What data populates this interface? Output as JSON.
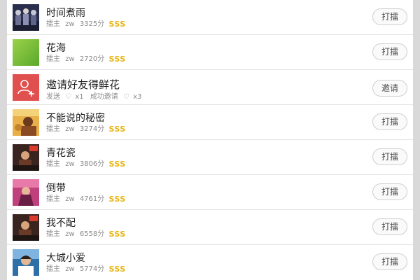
{
  "songs": [
    {
      "title": "时间煮雨",
      "owner_label": "擂主",
      "user": "zw",
      "score": "3325分",
      "rank": "SSS",
      "button": "打擂",
      "thumb_color": "#2a2f4e"
    },
    {
      "title": "花海",
      "owner_label": "擂主",
      "user": "zw",
      "score": "2720分",
      "rank": "SSS",
      "button": "打擂",
      "thumb_color": "#7cc23a"
    },
    {
      "title": "不能说的秘密",
      "owner_label": "擂主",
      "user": "zw",
      "score": "3274分",
      "rank": "SSS",
      "button": "打擂",
      "thumb_color": "#c4832a"
    },
    {
      "title": "青花瓷",
      "owner_label": "擂主",
      "user": "zw",
      "score": "3806分",
      "rank": "SSS",
      "button": "打擂",
      "thumb_color": "#4a2a22"
    },
    {
      "title": "倒带",
      "owner_label": "擂主",
      "user": "zw",
      "score": "4761分",
      "rank": "SSS",
      "button": "打擂",
      "thumb_color": "#b0307a"
    },
    {
      "title": "我不配",
      "owner_label": "擂主",
      "user": "zw",
      "score": "6558分",
      "rank": "SSS",
      "button": "打擂",
      "thumb_color": "#4a2a22"
    },
    {
      "title": "大城小爱",
      "owner_label": "擂主",
      "user": "zw",
      "score": "5774分",
      "rank": "SSS",
      "button": "打擂",
      "thumb_color": "#2f6fa8"
    }
  ],
  "invite": {
    "title": "邀请好友得鲜花",
    "sent_label": "发送",
    "sent_count": "x1",
    "success_label": "成功邀请",
    "success_count": "x3",
    "button": "邀请",
    "icon": "add-user-icon",
    "icon_bg": "#e0504f"
  }
}
